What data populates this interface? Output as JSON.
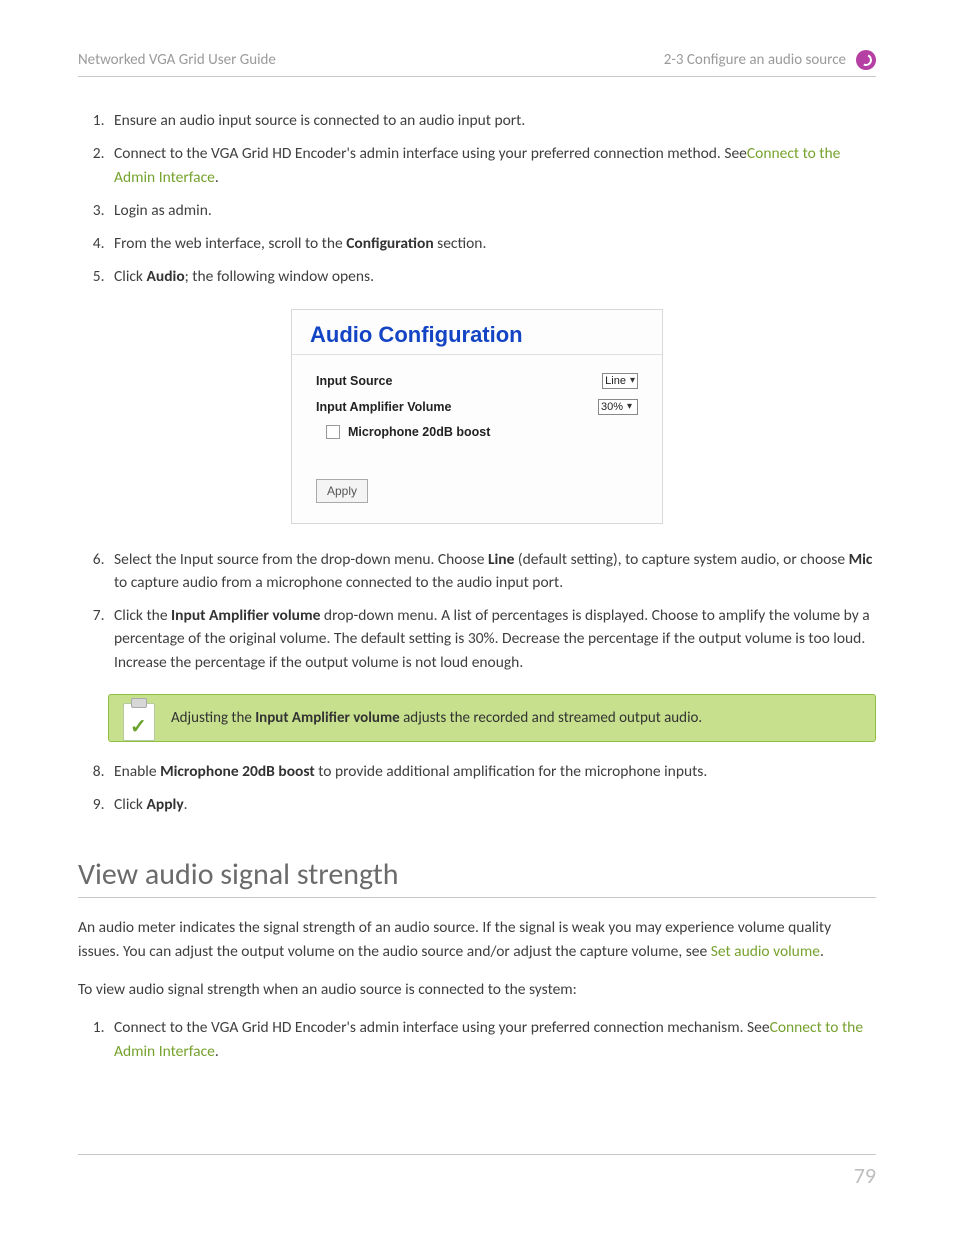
{
  "header": {
    "left": "Networked VGA Grid User Guide",
    "right": "2-3 Configure an audio source"
  },
  "steps_a": {
    "s1": "Ensure an audio input source is connected to an audio input port.",
    "s2_pre": "Connect to the VGA Grid HD Encoder's admin interface using your preferred connection method. See",
    "s2_link": "Connect to the Admin Interface",
    "s2_post": ".",
    "s3": "Login as admin.",
    "s4_pre": "From the web interface, scroll to the ",
    "s4_bold": "Configuration",
    "s4_post": " section.",
    "s5_pre": "Click ",
    "s5_bold": "Audio",
    "s5_post": "; the following window opens."
  },
  "shot": {
    "title": "Audio Configuration",
    "row1": {
      "label": "Input Source",
      "value": "Line"
    },
    "row2": {
      "label": "Input Amplifier Volume",
      "value": "30%"
    },
    "check": "Microphone 20dB boost",
    "apply": "Apply"
  },
  "steps_b": {
    "s6_pre": "Select the Input source from the drop-down menu. Choose ",
    "s6_b1": "Line",
    "s6_mid": " (default setting), to capture system audio, or choose ",
    "s6_b2": "Mic",
    "s6_post": " to capture audio from a microphone connected to the audio input port.",
    "s7_pre": "Click the ",
    "s7_b": "Input Amplifier volume",
    "s7_post": " drop-down menu. A list of percentages is displayed. Choose to amplify the volume by a percentage of the original volume. The default setting is 30%. Decrease the percentage if the output volume is too loud. Increase the percentage if the output volume is not loud enough.",
    "note_pre": "Adjusting the ",
    "note_b": "Input Amplifier volume",
    "note_post": " adjusts the recorded and streamed output audio.",
    "s8_pre": "Enable ",
    "s8_b": "Microphone 20dB boost",
    "s8_post": " to provide additional amplification for the microphone inputs.",
    "s9_pre": "Click ",
    "s9_b": "Apply",
    "s9_post": "."
  },
  "section2": {
    "title": "View audio signal strength",
    "p1_pre": "An audio meter indicates the signal strength of an audio source. If the signal is weak you may experience volume quality issues. You can adjust the output volume on the audio source and/or adjust the capture volume, see ",
    "p1_link": "Set audio volume",
    "p1_post": ".",
    "p2": "To view audio signal strength when an audio source is connected to the system:",
    "s1_pre": "Connect to the VGA Grid HD Encoder's admin interface using your preferred connection mechanism. See",
    "s1_link": "Connect to the Admin Interface",
    "s1_post": "."
  },
  "page_number": "79"
}
